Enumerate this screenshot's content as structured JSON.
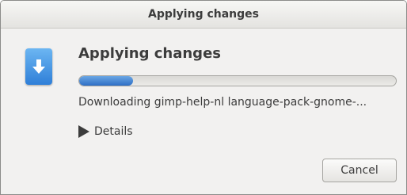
{
  "window": {
    "title": "Applying changes"
  },
  "main": {
    "icon": "download-icon",
    "heading": "Applying changes",
    "progress": 0.17,
    "status": "Downloading gimp-help-nl language-pack-gnome-...",
    "details_label": "Details",
    "details_icon": "expander-arrow-icon"
  },
  "buttons": {
    "cancel_label": "Cancel"
  },
  "colors": {
    "progress_fill": "#3d7fd3",
    "window_bg": "#f2f1f0",
    "icon_bg": "#4a99e6"
  }
}
